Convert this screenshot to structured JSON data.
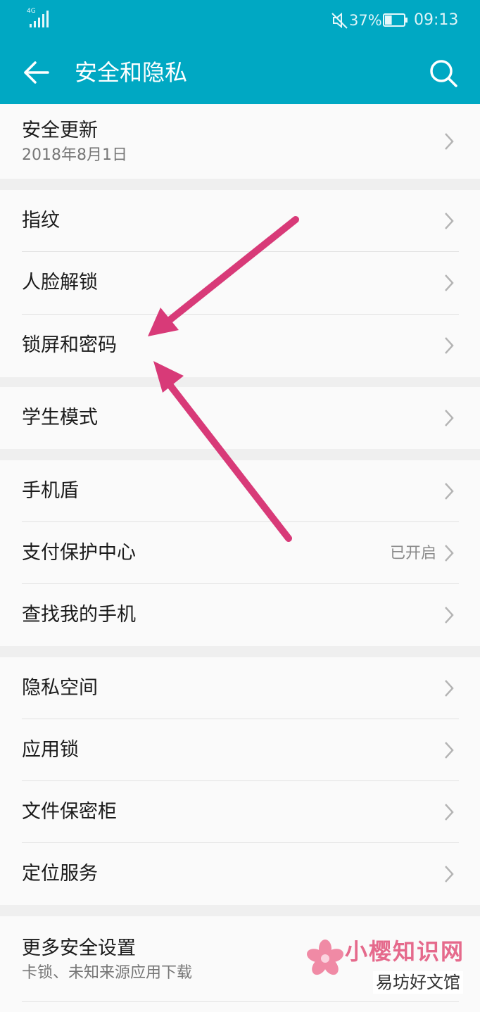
{
  "status_bar": {
    "network": "4G",
    "battery_percent": "37%",
    "battery_level": 0.37,
    "time": "09:13",
    "icons": [
      "signal-icon",
      "mute-icon",
      "battery-icon"
    ]
  },
  "header": {
    "title": "安全和隐私",
    "background_color": "#00a8c3",
    "icons": [
      "back-arrow-icon",
      "search-icon"
    ]
  },
  "sections": [
    {
      "items": [
        {
          "label": "安全更新",
          "subtitle": "2018年8月1日"
        }
      ]
    },
    {
      "items": [
        {
          "label": "指纹"
        },
        {
          "label": "人脸解锁"
        },
        {
          "label": "锁屏和密码"
        }
      ]
    },
    {
      "items": [
        {
          "label": "学生模式"
        }
      ]
    },
    {
      "items": [
        {
          "label": "手机盾"
        },
        {
          "label": "支付保护中心",
          "value": "已开启"
        },
        {
          "label": "查找我的手机"
        }
      ]
    },
    {
      "items": [
        {
          "label": "隐私空间"
        },
        {
          "label": "应用锁"
        },
        {
          "label": "文件保密柜"
        },
        {
          "label": "定位服务"
        }
      ]
    },
    {
      "items": [
        {
          "label": "更多安全设置",
          "subtitle": "卡锁、未知来源应用下载"
        }
      ]
    }
  ],
  "annotation": {
    "arrow_color": "#d83a78",
    "target": "锁屏和密码"
  },
  "watermark": {
    "text": "小樱知识网",
    "subtext": "易坊好文馆"
  }
}
